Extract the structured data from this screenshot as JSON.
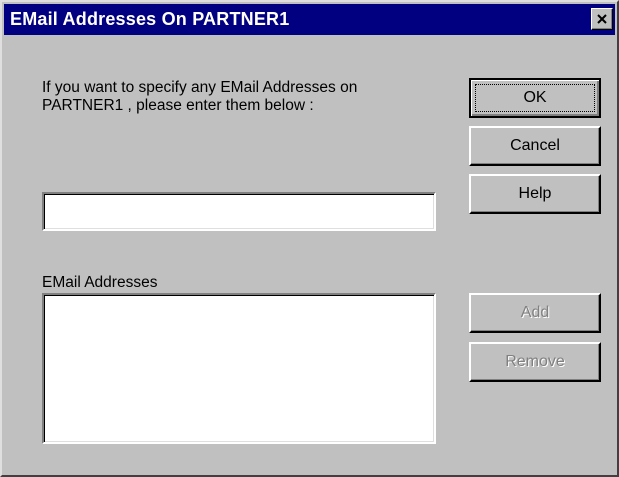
{
  "window": {
    "title": "EMail Addresses On PARTNER1",
    "close_icon": "close-icon"
  },
  "dialog": {
    "instruction": "If you want to specify any EMail Addresses on\nPARTNER1 , please enter them below :",
    "email_input_value": "",
    "list_label": "EMail Addresses",
    "list_items": []
  },
  "buttons": {
    "ok": "OK",
    "cancel": "Cancel",
    "help": "Help",
    "add": "Add",
    "remove": "Remove"
  },
  "states": {
    "add_enabled": false,
    "remove_enabled": false,
    "default_button": "ok"
  },
  "colors": {
    "titlebar": "#000080",
    "face": "#c0c0c0",
    "disabled_text": "#808080"
  }
}
